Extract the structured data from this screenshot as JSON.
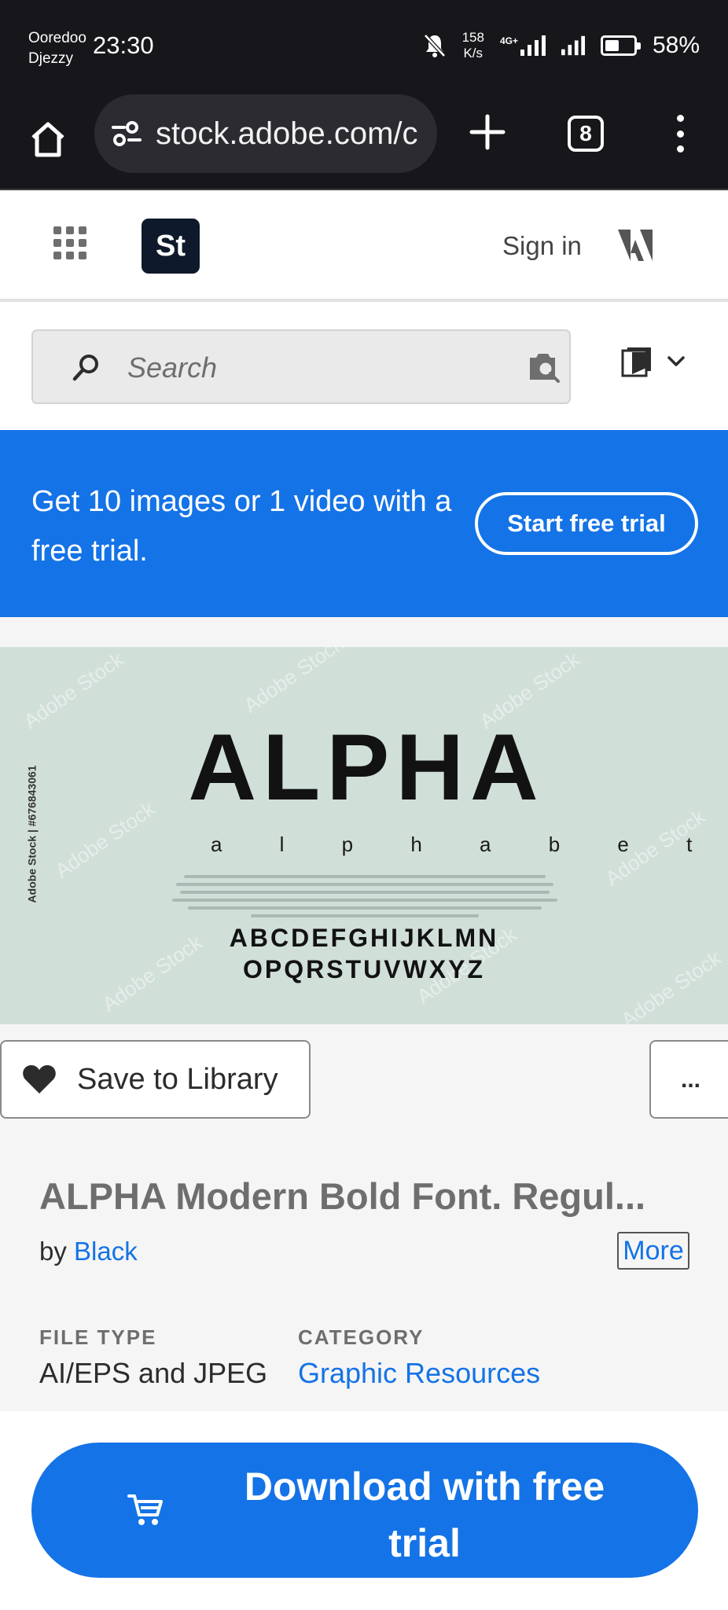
{
  "status_bar": {
    "carrier_1": "Ooredoo",
    "carrier_2": "Djezzy",
    "time": "23:30",
    "net_speed_value": "158",
    "net_speed_unit": "K/s",
    "network_type": "4G+",
    "battery_percent": "58%",
    "battery_level": 0.58
  },
  "browser": {
    "url": "stock.adobe.com/c",
    "tab_count": "8"
  },
  "header": {
    "logo_text": "St",
    "sign_in": "Sign in"
  },
  "search": {
    "placeholder": "Search"
  },
  "promo": {
    "text": "Get 10 images or 1 video with a free trial.",
    "button": "Start free trial"
  },
  "preview": {
    "title": "ALPHA",
    "subtitle": "a l p h a b e t",
    "alphabet_line_1": "ABCDEFGHIJKLMN",
    "alphabet_line_2": "OPQRSTUVWXYZ",
    "credit": "Adobe Stock | #676843061",
    "watermark": "Adobe Stock"
  },
  "actions": {
    "save": "Save to Library",
    "more": "..."
  },
  "asset": {
    "title": "ALPHA Modern Bold Font. Regul...",
    "by_prefix": "by",
    "author": "Black",
    "more_link": "More",
    "file_type_label": "FILE TYPE",
    "file_type_value": "AI/EPS and JPEG",
    "category_label": "CATEGORY",
    "category_value": "Graphic Resources"
  },
  "download": {
    "button": "Download with free trial"
  },
  "colors": {
    "adobe_blue": "#1473e6",
    "status_bar_bg": "#16161b",
    "preview_bg": "#d1dfd9"
  }
}
